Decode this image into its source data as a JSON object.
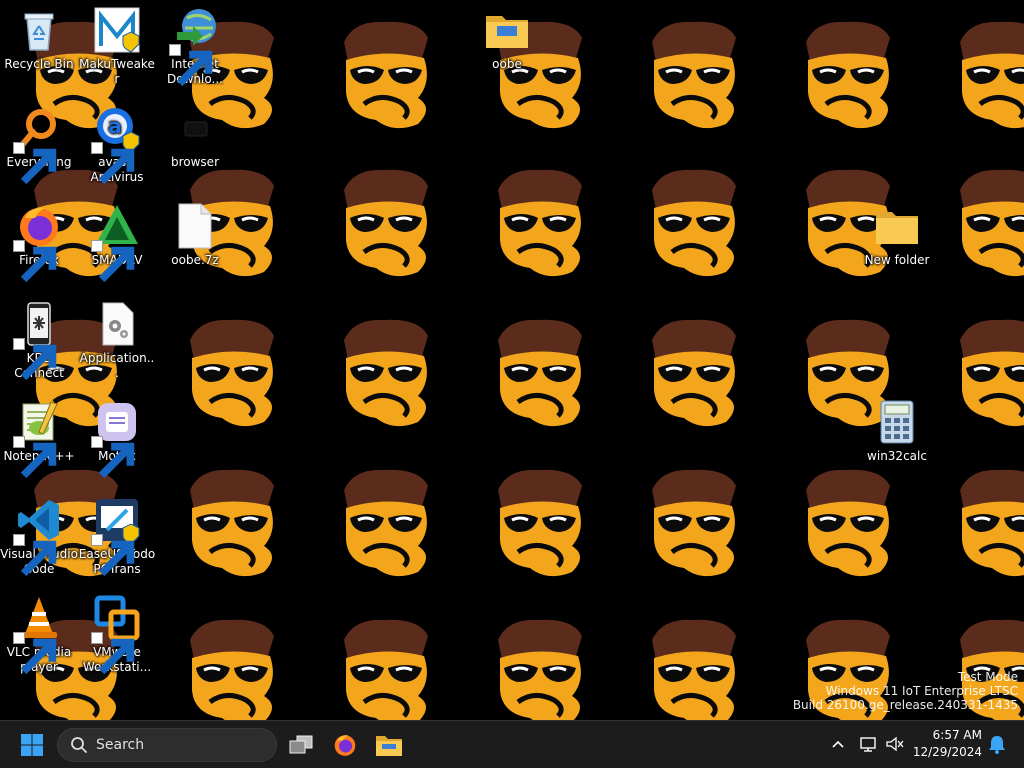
{
  "desktop": {
    "icons": [
      {
        "label": "Recycle Bin",
        "icon": "recycle-bin-icon"
      },
      {
        "label": "MakuTweaker",
        "icon": "makutweaker-icon"
      },
      {
        "label": "Internet Downlo...",
        "icon": "internet-download-manager-icon"
      },
      {
        "label": "oobe",
        "icon": "folder-icon"
      },
      {
        "label": "Everything",
        "icon": "everything-search-icon"
      },
      {
        "label": "avast! Antivirus",
        "icon": "avast-icon"
      },
      {
        "label": "browser",
        "icon": "browser-icon"
      },
      {
        "label": "Firefox",
        "icon": "firefox-icon"
      },
      {
        "label": "SMADAV",
        "icon": "smadav-icon"
      },
      {
        "label": "oobe.7z",
        "icon": "archive-file-icon"
      },
      {
        "label": "New folder",
        "icon": "folder-icon"
      },
      {
        "label": "KDE Connect",
        "icon": "kde-connect-icon"
      },
      {
        "label": "Application...",
        "icon": "application-file-icon"
      },
      {
        "label": "Notepad++",
        "icon": "notepad-plus-plus-icon"
      },
      {
        "label": "Motrix",
        "icon": "motrix-icon"
      },
      {
        "label": "win32calc",
        "icon": "calculator-icon"
      },
      {
        "label": "Visual Studio Code",
        "icon": "vscode-icon"
      },
      {
        "label": "EaseUS Todo PCTrans",
        "icon": "easeus-pctrans-icon"
      },
      {
        "label": "VLC media player",
        "icon": "vlc-icon"
      },
      {
        "label": "VMware Workstati...",
        "icon": "vmware-icon"
      }
    ]
  },
  "watermark": {
    "line1": "Test Mode",
    "line2": "Windows 11 IoT Enterprise LTSC",
    "line3": "Build 26100.ge_release.240331-1435"
  },
  "taskbar": {
    "search_placeholder": "Search",
    "time": "6:57 AM",
    "date": "12/29/2024"
  },
  "colors": {
    "taskbar_bg": "#1c1c1c",
    "desktop_bg": "#000000",
    "accent_blue": "#0078d4"
  }
}
